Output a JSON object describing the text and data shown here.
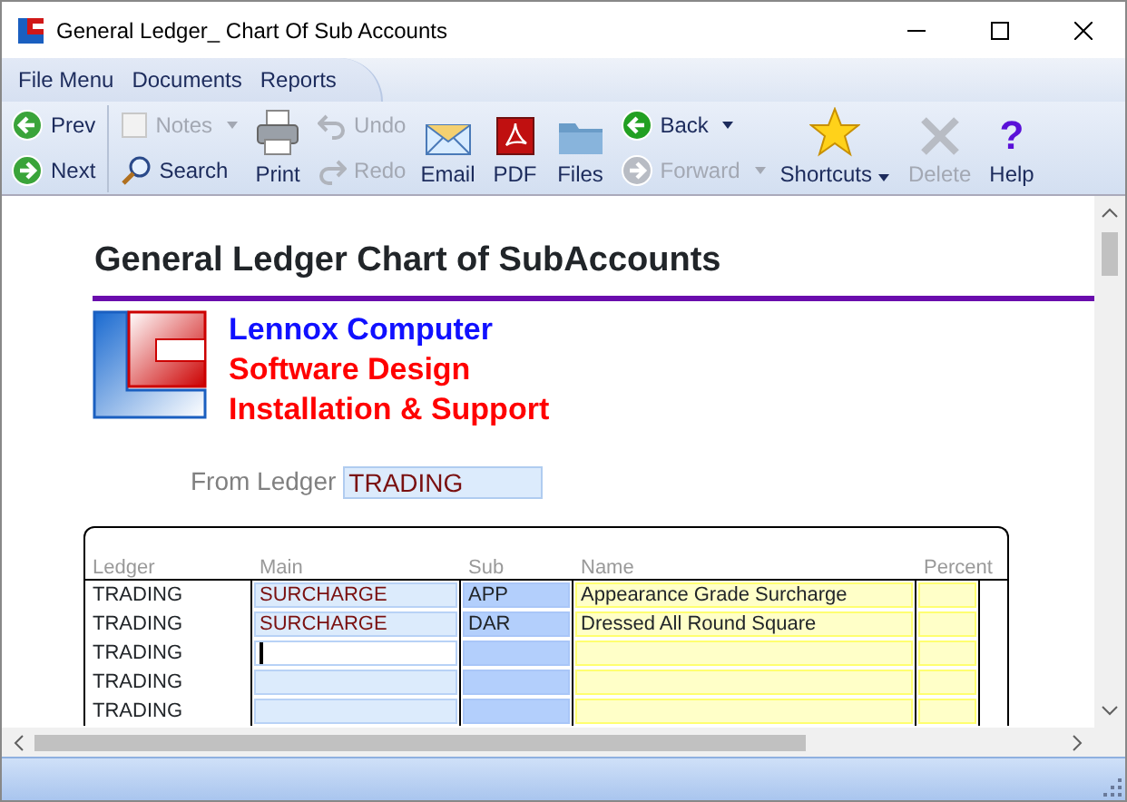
{
  "window": {
    "title": "General Ledger_ Chart Of Sub Accounts"
  },
  "menu": [
    "File Menu",
    "Documents",
    "Reports"
  ],
  "toolbar": [
    {
      "kind": "stack",
      "items": [
        {
          "label": "Prev",
          "disabled": false,
          "dropdown": false
        },
        {
          "label": "Next",
          "disabled": false,
          "dropdown": false
        }
      ]
    },
    {
      "kind": "stack",
      "items": [
        {
          "label": "Notes",
          "disabled": true,
          "dropdown": true
        },
        {
          "label": "Search",
          "disabled": false,
          "dropdown": false
        }
      ]
    },
    {
      "kind": "large",
      "label": "Print",
      "disabled": false,
      "dropdown": false
    },
    {
      "kind": "stack",
      "items": [
        {
          "label": "Undo",
          "disabled": true,
          "dropdown": false
        },
        {
          "label": "Redo",
          "disabled": true,
          "dropdown": false
        }
      ]
    },
    {
      "kind": "large",
      "label": "Email",
      "disabled": false,
      "dropdown": false
    },
    {
      "kind": "large",
      "label": "PDF",
      "disabled": false,
      "dropdown": false
    },
    {
      "kind": "large",
      "label": "Files",
      "disabled": false,
      "dropdown": false
    },
    {
      "kind": "stack",
      "items": [
        {
          "label": "Back",
          "disabled": false,
          "dropdown": true
        },
        {
          "label": "Forward",
          "disabled": true,
          "dropdown": true
        }
      ]
    },
    {
      "kind": "large",
      "label": "Shortcuts",
      "disabled": false,
      "dropdown": true
    },
    {
      "kind": "large",
      "label": "Delete",
      "disabled": true,
      "dropdown": false
    },
    {
      "kind": "large",
      "label": "Help",
      "disabled": false,
      "dropdown": false,
      "glyph": "?"
    }
  ],
  "report": {
    "title": "General Ledger Chart of SubAccounts",
    "company_lines": [
      {
        "text": "Lennox Computer",
        "color": "#1010ff"
      },
      {
        "text": "Software Design",
        "color": "#ff0000"
      },
      {
        "text": "Installation & Support",
        "color": "#ff0000"
      }
    ],
    "from_ledger": {
      "label": "From Ledger",
      "value": "TRADING"
    }
  },
  "table": {
    "columns": [
      "Ledger",
      "Main",
      "Sub",
      "Name",
      "Percent"
    ],
    "rows": [
      {
        "ledger": "TRADING",
        "main": "SURCHARGE",
        "sub": "APP",
        "name": "Appearance Grade Surcharge",
        "main_focused": false
      },
      {
        "ledger": "TRADING",
        "main": "SURCHARGE",
        "sub": "DAR",
        "name": "Dressed All Round Square",
        "main_focused": false
      },
      {
        "ledger": "TRADING",
        "main_focused": true
      },
      {
        "ledger": "TRADING",
        "main_focused": false
      },
      {
        "ledger": "TRADING",
        "main_focused": false
      }
    ]
  }
}
